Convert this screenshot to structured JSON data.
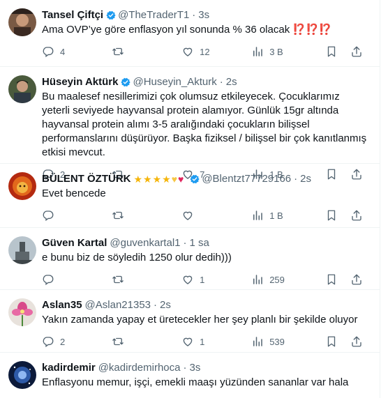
{
  "tweets": [
    {
      "name": "Tansel Çiftçi",
      "handle": "@TheTraderT1",
      "time": "3s",
      "text_main": "Ama OVP’ye göre enflasyon yıl sonunda % 36 olacak ",
      "text_emphasis": "⁉️⁉️⁉️",
      "replies": "4",
      "retweets": "",
      "likes": "12",
      "views": "3 B",
      "verified": true
    },
    {
      "name": "Hüseyin Aktürk",
      "handle": "@Huseyin_Akturk",
      "time": "2s",
      "text": "Bu maalesef nesillerimizi çok olumsuz etkileyecek. Çocuklarımız yeterli seviyede hayvansal protein alamıyor. Günlük 15gr altında hayvansal protein alımı 3-5 aralığındaki çocukların bilişsel performanslarını düşürüyor. Başka fiziksel / bilişsel bir çok kanıtlanmış etkisi mevcut.",
      "replies": "2",
      "retweets": "",
      "likes": "7",
      "views": "1 B",
      "verified": true
    },
    {
      "name": "BÜLENT ÖZTÜRK",
      "handle": "@Blentzt77729166",
      "time": "2s",
      "text": "Evet bencede",
      "replies": "",
      "retweets": "",
      "likes": "",
      "views": "1 B",
      "verified": true
    },
    {
      "name": "Güven Kartal",
      "handle": "@guvenkartal1",
      "time": "1 sa",
      "text": "e bunu biz de söyledih 1250 olur dedih)))",
      "replies": "",
      "retweets": "",
      "likes": "1",
      "views": "259",
      "verified": false
    },
    {
      "name": "Aslan35",
      "handle": "@Aslan21353",
      "time": "2s",
      "text": "Yakın zamanda yapay et üretecekler her şey planlı bir şekilde oluyor",
      "replies": "2",
      "retweets": "",
      "likes": "1",
      "views": "539",
      "verified": false
    },
    {
      "name": "kadirdemir",
      "handle": "@kadirdemirhoca",
      "time": "3s",
      "text": "Enflasyonu memur, işçi, emekli maaşı yüzünden sananlar var hala",
      "verified": false
    }
  ],
  "ui": {
    "separator": "·",
    "more": "···",
    "emoji_stars": "★★★★",
    "emoji_yellow_heart": "♥",
    "emoji_red_heart": "♥"
  },
  "colors": {
    "verified": "#1d9bf0",
    "secondary_text": "#536471",
    "border": "#eff3f4"
  }
}
